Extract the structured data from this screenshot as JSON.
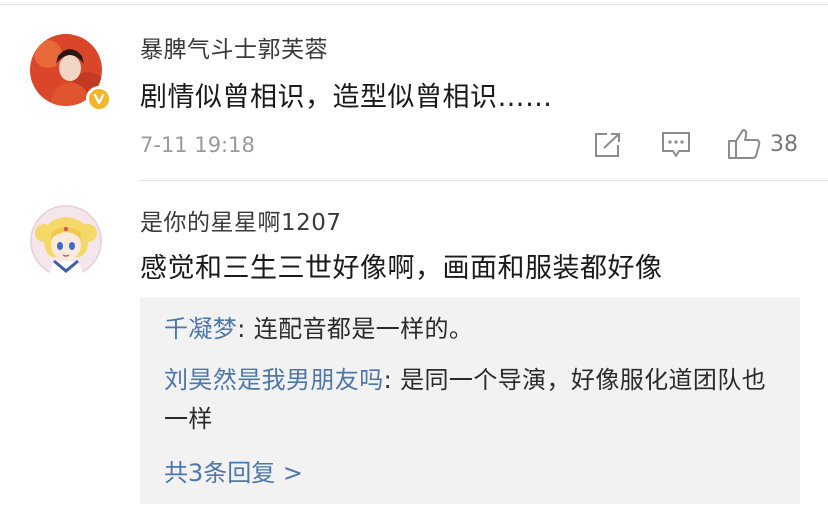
{
  "comments": [
    {
      "username": "暴脾气斗士郭芙蓉",
      "text": "剧情似曾相识，造型似曾相识……",
      "time": "7-11 19:18",
      "likes": "38",
      "verified": true,
      "avatar_icon": "user-avatar-red",
      "actions": [
        "share-icon",
        "comment-icon",
        "like-icon"
      ]
    },
    {
      "username": "是你的星星啊1207",
      "text": "感觉和三生三世好像啊，画面和服装都好像",
      "avatar_icon": "user-avatar-cartoon",
      "replies": [
        {
          "name": "千凝梦",
          "separator": ": ",
          "text": "连配音都是一样的。"
        },
        {
          "name": "刘昊然是我男朋友吗",
          "separator": ": ",
          "text": "是同一个导演，好像服化道团队也一样"
        }
      ],
      "more_replies": "共3条回复 >"
    }
  ],
  "colors": {
    "link": "#4d76a9",
    "badge": "#f5b52a",
    "reply_bg": "#f2f2f2",
    "meta": "#9a9a9a"
  }
}
